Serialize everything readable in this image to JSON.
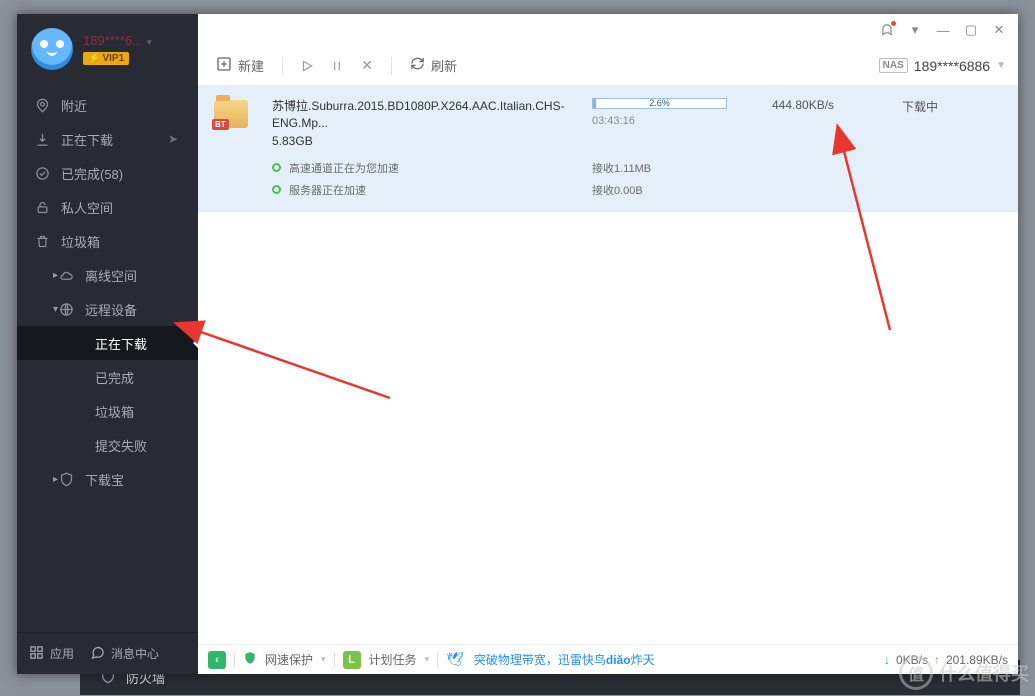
{
  "sidebar": {
    "username": "189****6...",
    "vip": "VIP1",
    "items": [
      {
        "label": "附近"
      },
      {
        "label": "正在下载"
      },
      {
        "label": "已完成(58)"
      },
      {
        "label": "私人空间"
      },
      {
        "label": "垃圾箱"
      },
      {
        "label": "离线空间"
      },
      {
        "label": "远程设备"
      },
      {
        "label": "正在下载"
      },
      {
        "label": "已完成"
      },
      {
        "label": "垃圾箱"
      },
      {
        "label": "提交失败"
      },
      {
        "label": "下载宝"
      }
    ],
    "footer": {
      "apps": "应用",
      "msgs": "消息中心"
    }
  },
  "under": {
    "firewall": "防火墙"
  },
  "toolbar": {
    "new": "新建",
    "refresh": "刷新",
    "nas": "NAS",
    "device": "189****6886"
  },
  "download": {
    "filename": "苏博拉.Suburra.2015.BD1080P.X264.AAC.Italian.CHS-ENG.Mp...",
    "size": "5.83GB",
    "progress_pct": "2.6%",
    "progress_width": "2.6%",
    "eta": "03:43:16",
    "speed": "444.80KB/s",
    "status": "下载中",
    "accel1": "高速通道正在为您加速",
    "recv1": "接收1.11MB",
    "accel2": "服务器正在加速",
    "recv2": "接收0.00B",
    "bt": "BT"
  },
  "statusbar": {
    "netprotect": "网速保护",
    "sched": "计划任务",
    "promo_a": "突破物理带宽，迅雷快鸟",
    "promo_b": "diǎo",
    "promo_c": "炸天",
    "dl": "0KB/s",
    "ul": "201.89KB/s"
  },
  "watermark": {
    "char": "值",
    "text": "什么值得买"
  }
}
